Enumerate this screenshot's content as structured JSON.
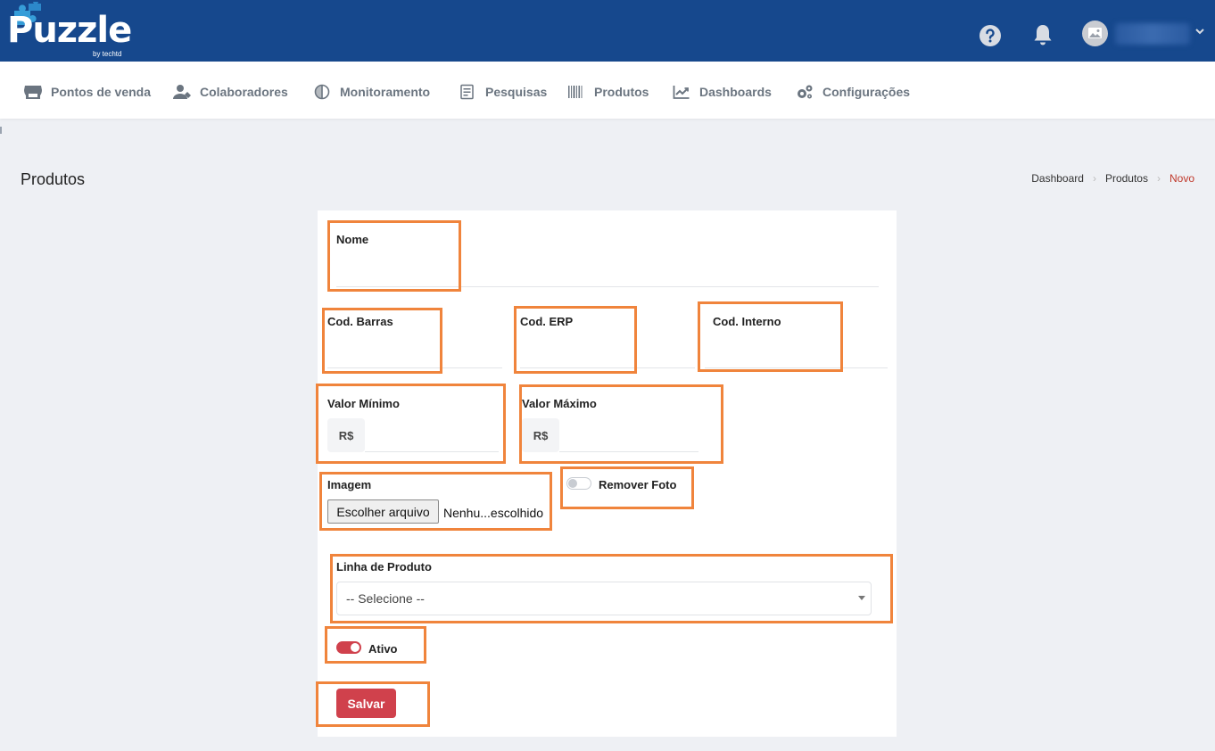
{
  "app": {
    "logo_text": "Puzzle",
    "logo_subtext": "by techtd"
  },
  "header_icons": {
    "help": "question-circle-icon",
    "notifications": "bell-icon",
    "avatar": "image-placeholder-icon",
    "user_menu": "chevron-down-icon"
  },
  "nav": {
    "items": [
      {
        "label": "Pontos de venda",
        "icon": "store-icon"
      },
      {
        "label": "Colaboradores",
        "icon": "users-icon"
      },
      {
        "label": "Monitoramento",
        "icon": "compass-icon"
      },
      {
        "label": "Pesquisas",
        "icon": "clipboard-icon"
      },
      {
        "label": "Produtos",
        "icon": "barcode-icon"
      },
      {
        "label": "Dashboards",
        "icon": "chart-line-icon"
      },
      {
        "label": "Configurações",
        "icon": "gears-icon"
      }
    ]
  },
  "page": {
    "title": "Produtos",
    "breadcrumb": [
      "Dashboard",
      "Produtos",
      "Novo"
    ]
  },
  "form": {
    "nome_label": "Nome",
    "cod_barras_label": "Cod. Barras",
    "cod_erp_label": "Cod. ERP",
    "cod_interno_label": "Cod. Interno",
    "valor_minimo_label": "Valor Mínimo",
    "valor_maximo_label": "Valor Máximo",
    "currency_prefix": "R$",
    "imagem_label": "Imagem",
    "file_button_label": "Escolher arquivo",
    "file_status": "Nenhu...escolhido",
    "remover_foto_label": "Remover Foto",
    "remover_foto_on": false,
    "linha_produto_label": "Linha de Produto",
    "linha_produto_selected": "-- Selecione --",
    "ativo_label": "Ativo",
    "ativo_on": true,
    "save_label": "Salvar"
  },
  "colors": {
    "topbar": "#16488d",
    "highlight": "#f0843c",
    "accent_red": "#d0414c",
    "nav_text": "#6b7580"
  }
}
